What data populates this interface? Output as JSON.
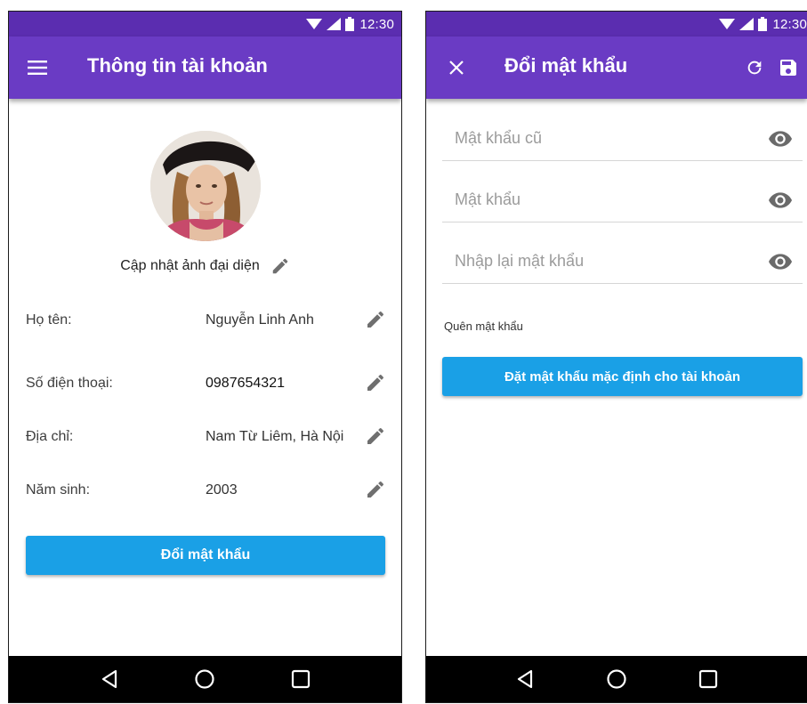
{
  "status_bar": {
    "time": "12:30",
    "icons": [
      "wifi-icon",
      "signal-icon",
      "battery-icon"
    ]
  },
  "account_screen": {
    "title": "Thông tin tài khoản",
    "avatar_caption": "Cập nhật ảnh đại diện",
    "fields": [
      {
        "label": "Họ tên:",
        "value": "Nguyễn Linh Anh"
      },
      {
        "label": "Số điện thoại:",
        "value": "0987654321"
      },
      {
        "label": "Địa chỉ:",
        "value": "Nam Từ Liêm, Hà Nội"
      },
      {
        "label": "Năm sinh:",
        "value": "2003"
      }
    ],
    "change_password_label": "Đổi mật khẩu"
  },
  "password_screen": {
    "title": "Đổi mật khẩu",
    "old_password_placeholder": "Mật khẩu cũ",
    "new_password_placeholder": "Mật khẩu",
    "confirm_password_placeholder": "Nhập lại mật khẩu",
    "forgot_password_label": "Quên mật khẩu",
    "reset_default_label": "Đặt mật khẩu mặc định cho tài khoản"
  },
  "colors": {
    "status_bar": "#5b2db0",
    "app_bar": "#6a3bc4",
    "primary_button": "#1aa0e6",
    "nav_bar": "#000000"
  }
}
